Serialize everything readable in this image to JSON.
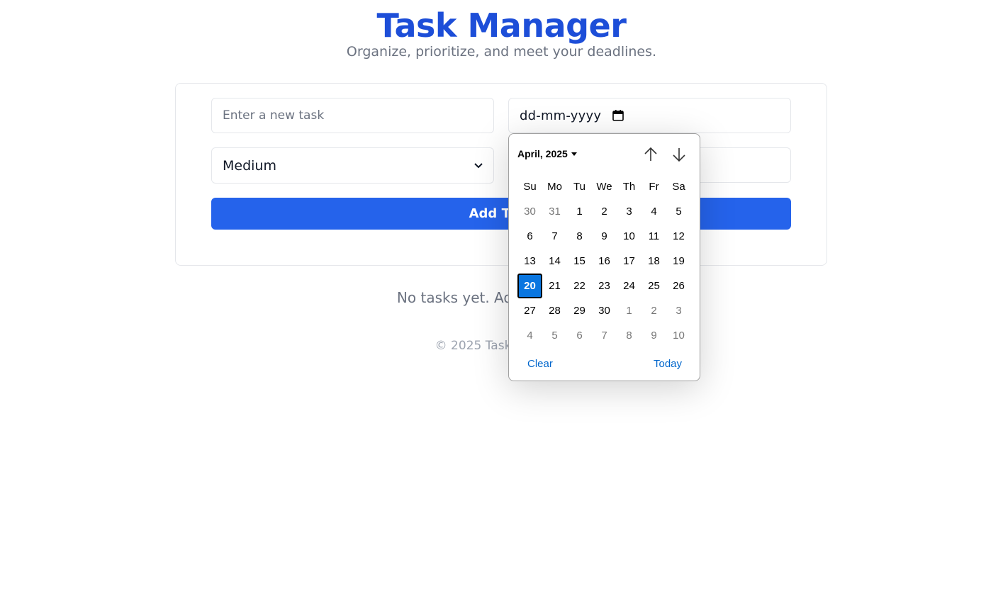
{
  "header": {
    "title": "Task Manager",
    "subtitle": "Organize, prioritize, and meet your deadlines."
  },
  "form": {
    "task_placeholder": "Enter a new task",
    "date_placeholder": "dd-mm-yyyy",
    "priority_value": "Medium",
    "add_button_label": "Add Task"
  },
  "empty_message": "No tasks yet. Add one above!",
  "footer": "© 2025 Task Manager",
  "datepicker": {
    "month_label": "April, 2025",
    "weekdays": [
      "Su",
      "Mo",
      "Tu",
      "We",
      "Th",
      "Fr",
      "Sa"
    ],
    "weeks": [
      [
        {
          "d": "30",
          "o": true
        },
        {
          "d": "31",
          "o": true
        },
        {
          "d": "1"
        },
        {
          "d": "2"
        },
        {
          "d": "3"
        },
        {
          "d": "4"
        },
        {
          "d": "5"
        }
      ],
      [
        {
          "d": "6"
        },
        {
          "d": "7"
        },
        {
          "d": "8"
        },
        {
          "d": "9"
        },
        {
          "d": "10"
        },
        {
          "d": "11"
        },
        {
          "d": "12"
        }
      ],
      [
        {
          "d": "13"
        },
        {
          "d": "14"
        },
        {
          "d": "15"
        },
        {
          "d": "16"
        },
        {
          "d": "17"
        },
        {
          "d": "18"
        },
        {
          "d": "19"
        }
      ],
      [
        {
          "d": "20",
          "s": true
        },
        {
          "d": "21"
        },
        {
          "d": "22"
        },
        {
          "d": "23"
        },
        {
          "d": "24"
        },
        {
          "d": "25"
        },
        {
          "d": "26"
        }
      ],
      [
        {
          "d": "27"
        },
        {
          "d": "28"
        },
        {
          "d": "29"
        },
        {
          "d": "30"
        },
        {
          "d": "1",
          "o": true
        },
        {
          "d": "2",
          "o": true
        },
        {
          "d": "3",
          "o": true
        }
      ],
      [
        {
          "d": "4",
          "o": true
        },
        {
          "d": "5",
          "o": true
        },
        {
          "d": "6",
          "o": true
        },
        {
          "d": "7",
          "o": true
        },
        {
          "d": "8",
          "o": true
        },
        {
          "d": "9",
          "o": true
        },
        {
          "d": "10",
          "o": true
        }
      ]
    ],
    "clear_label": "Clear",
    "today_label": "Today"
  },
  "colors": {
    "accent": "#2563eb",
    "title": "#1d4ed8",
    "selected_day": "#0a76e0"
  }
}
